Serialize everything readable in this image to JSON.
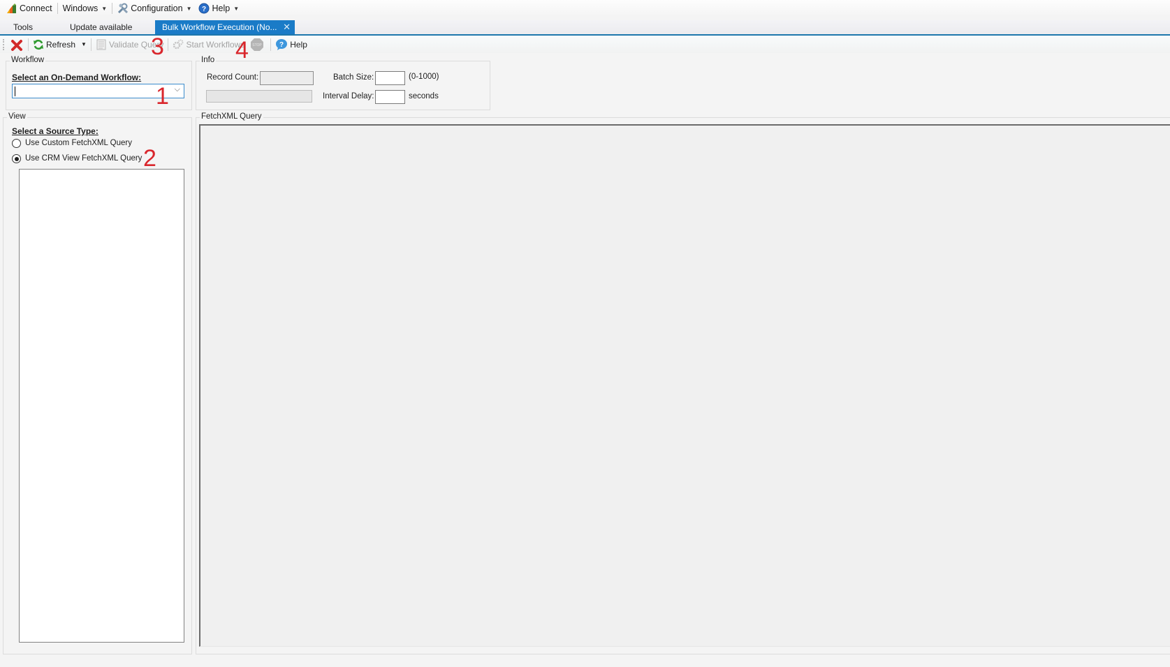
{
  "menubar": {
    "connect": "Connect",
    "windows": "Windows",
    "configuration": "Configuration",
    "help": "Help"
  },
  "tabs": [
    {
      "label": "Tools",
      "active": false
    },
    {
      "label": "Update available",
      "active": false
    },
    {
      "label": "Bulk Workflow Execution (No...",
      "active": true
    }
  ],
  "toolbar": {
    "refresh": "Refresh",
    "validate_query": "Validate Query",
    "start_workflows": "Start Workflows",
    "stop": "STOP",
    "help": "Help"
  },
  "annotations": [
    "1",
    "2",
    "3",
    "4"
  ],
  "workflow_group": {
    "title": "Workflow",
    "prompt": "Select an On-Demand Workflow:",
    "selected_value": ""
  },
  "info_group": {
    "title": "Info",
    "record_count_label": "Record Count:",
    "record_count_value": "",
    "batch_size_label": "Batch Size:",
    "batch_size_value": "",
    "batch_size_hint": "(0-1000)",
    "interval_delay_label": "Interval Delay:",
    "interval_delay_value": "",
    "interval_delay_unit": "seconds",
    "progress": 0
  },
  "view_group": {
    "title": "View",
    "prompt": "Select a Source Type:",
    "options": [
      {
        "label": "Use Custom FetchXML Query",
        "checked": false
      },
      {
        "label": "Use CRM View FetchXML Query",
        "checked": true
      }
    ],
    "views": []
  },
  "fetchxml_group": {
    "title": "FetchXML Query",
    "content": ""
  },
  "colors": {
    "accent": "#1a7bc7",
    "annotation": "#d9262c"
  }
}
